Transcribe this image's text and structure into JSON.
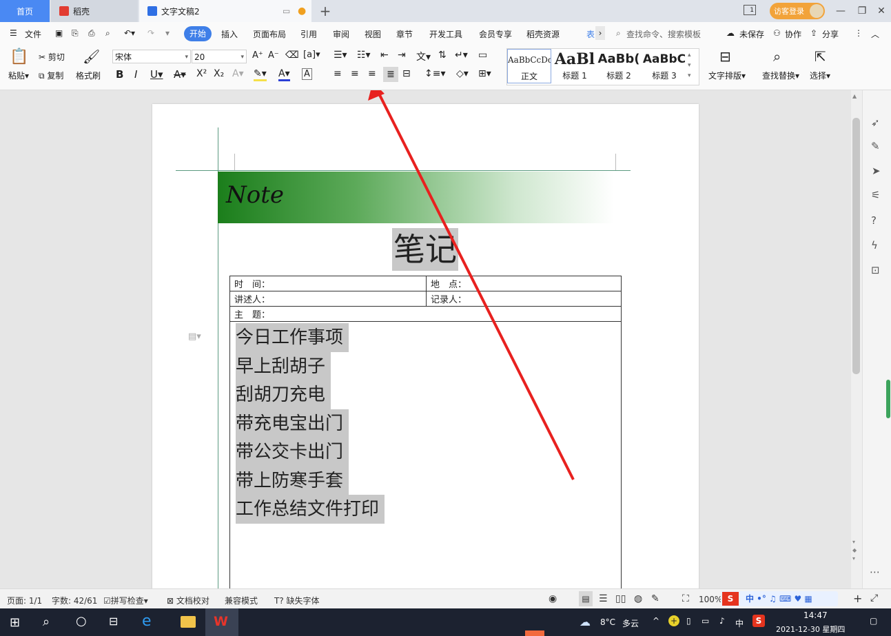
{
  "titlebar": {
    "tabs": [
      {
        "label": "首页"
      },
      {
        "label": "稻壳"
      },
      {
        "label": "文字文稿2"
      }
    ],
    "visitor_login": "访客登录",
    "layout_badge": "1"
  },
  "menubar": {
    "file": "文件",
    "items": [
      "开始",
      "插入",
      "页面布局",
      "引用",
      "审阅",
      "视图",
      "章节",
      "开发工具",
      "会员专享",
      "稻壳资源",
      "表"
    ],
    "search_placeholder": "查找命令、搜索模板",
    "unsaved": "未保存",
    "collab": "协作",
    "share": "分享"
  },
  "ribbon": {
    "paste": "粘贴",
    "cut": "剪切",
    "copy": "复制",
    "format_painter": "格式刷",
    "font_name": "宋体",
    "font_size": "20",
    "styles": [
      {
        "sample": "AaBbCcDd",
        "label": "正文"
      },
      {
        "sample": "AaBl",
        "label": "标题 1"
      },
      {
        "sample": "AaBb(",
        "label": "标题 2"
      },
      {
        "sample": "AaBbC",
        "label": "标题 3"
      }
    ],
    "text_layout": "文字排版",
    "find_replace": "查找替换",
    "select": "选择"
  },
  "document": {
    "banner": "Note",
    "title": "笔记",
    "table": {
      "time": "时　间：",
      "place": "地　点：",
      "speaker": "讲述人：",
      "recorder": "记录人：",
      "topic": "主　题："
    },
    "lines": [
      "今日工作事项",
      "早上刮胡子",
      "刮胡刀充电",
      "带充电宝出门",
      "带公交卡出门",
      "带上防寒手套",
      "工作总结文件打印"
    ]
  },
  "statusbar": {
    "page": "页面: 1/1",
    "words": "字数: 42/61",
    "spellcheck": "拼写检查",
    "proofread": "文档校对",
    "compat": "兼容模式",
    "missing_font": "缺失字体",
    "zoom": "100%"
  },
  "taskbar": {
    "weather": "8°C",
    "weather_desc": "多云",
    "ime": "中",
    "time": "14:47",
    "date": "2021-12-30 星期四"
  },
  "colors": {
    "accent": "#3f7fe8",
    "visitor": "#f2a33a",
    "arrow": "#e8211f"
  }
}
